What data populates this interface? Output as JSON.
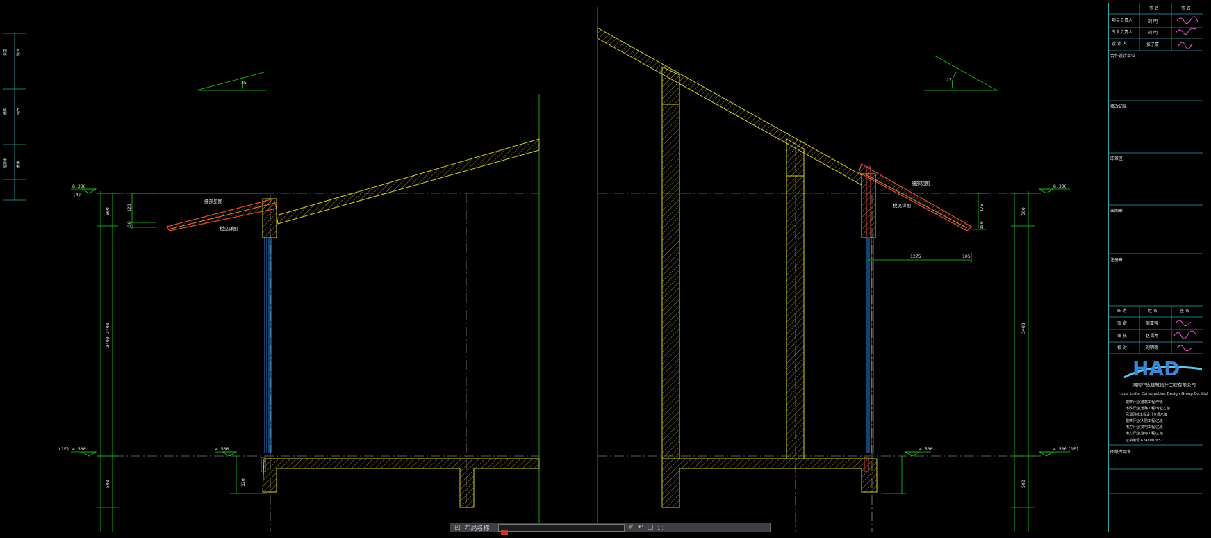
{
  "left_section": {
    "top_level": "8.300",
    "top_axis": "(4)",
    "floor_level": "4.500",
    "floor_tag": "(1F)",
    "inner_level": "4.500",
    "dim_top": "500",
    "dim_mid": "3400",
    "dim_bottom": "500",
    "small_dims": [
      "120",
      "50",
      "120"
    ],
    "callouts": [
      "细部见图",
      "棁见详图"
    ],
    "slope_note": "25"
  },
  "right_section": {
    "top_level": "8.300",
    "floor_level": "4.500",
    "floor_tag": "(1F)",
    "inner_level": "4.500",
    "dim_top": "500",
    "dim_mid": "3400",
    "dim_bottom": "500",
    "overhang_dim": "1275",
    "overhang_small": "105",
    "small_dims": [
      "475",
      "150"
    ],
    "callouts": [
      "细部见图",
      "棁见详图"
    ],
    "slope_note": "27"
  },
  "left_strip": {
    "cells": [
      "会签",
      "建筑",
      "结构",
      "电气",
      "给排水",
      "暖通"
    ]
  },
  "title_block": {
    "header": [
      "签 名",
      "签 名"
    ],
    "rows": [
      {
        "role": "项目负责人",
        "name": "刘 明"
      },
      {
        "role": "专业负责人",
        "name": "刘 明"
      },
      {
        "role": "设 计 人",
        "name": "张子豪"
      }
    ],
    "sections": [
      "合作设计单位",
      "修改记录",
      "印章区",
      "出图章",
      "注册章"
    ],
    "approval_header": [
      "职 务",
      "姓 名",
      "签 名"
    ],
    "approval": [
      {
        "role": "审 定",
        "name": "周亚强"
      },
      {
        "role": "审 核",
        "name": "赵福亮"
      },
      {
        "role": "校 对",
        "name": "刘明德"
      }
    ],
    "logo": "HAD",
    "company": "湖南华达建筑设计工程有限公司",
    "company_en": "Huda Unite Construction Design Group Co.,Ltd",
    "certs": [
      "建筑行业(建筑工程)甲级",
      "市政行业(道路工程)专业乙级",
      "风景园林工程设计专项乙级",
      "建筑行业(人防工程)乙级",
      "电力行业(变电工程)乙级",
      "电力行业(送电工程)乙级"
    ],
    "cert_no": "证书编号:A243007652",
    "footer": "图纸专用章"
  },
  "colors": {
    "frame": "#2aa6a6",
    "dim": "#19d119",
    "wall": "#d4cc2e",
    "red": "#e04a3a",
    "orange": "#e58b2c",
    "glazing": "#2a86e0",
    "text": "#e8e8e8",
    "pink": "#e85bd4",
    "axis": "#b9b9b9"
  },
  "toolbar": {
    "items": [
      "◰",
      "布局名称",
      "✐",
      "↶",
      "□",
      "⬚"
    ]
  }
}
